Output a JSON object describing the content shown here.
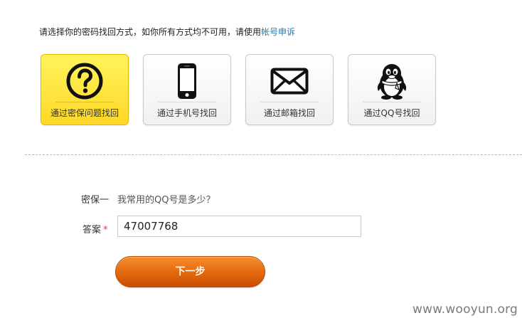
{
  "instruction": {
    "text": "请选择你的密码找回方式，如你所有方式均不可用，请使用",
    "link": "帐号申诉"
  },
  "methods": [
    {
      "label": "通过密保问题找回",
      "icon": "question-icon",
      "selected": true
    },
    {
      "label": "通过手机号找回",
      "icon": "phone-icon",
      "selected": false
    },
    {
      "label": "通过邮箱找回",
      "icon": "envelope-icon",
      "selected": false
    },
    {
      "label": "通过QQ号找回",
      "icon": "qq-penguin-icon",
      "selected": false
    }
  ],
  "form": {
    "question_label": "密保一",
    "question_text": "我常用的QQ号是多少？",
    "answer_label": "答案",
    "required_mark": "*",
    "answer_value": "47007768"
  },
  "next_button": "下一步",
  "watermark": "www.wooyun.org",
  "colors": {
    "accent_yellow": "#ffd829",
    "link_blue": "#1f78b4",
    "button_orange": "#e56a10",
    "required_red": "#e4393c"
  }
}
